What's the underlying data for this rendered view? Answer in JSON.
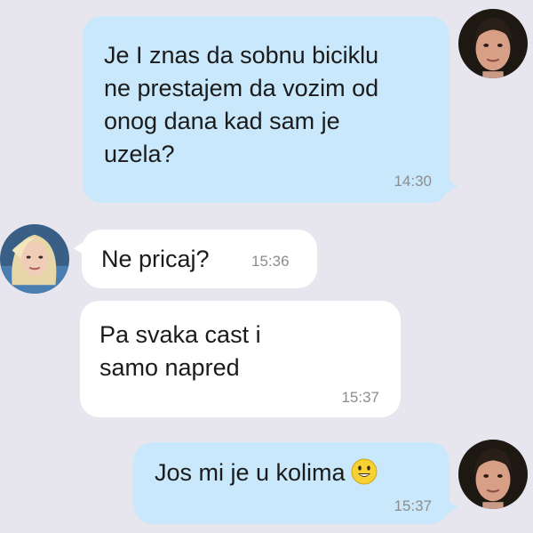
{
  "conversation": {
    "messages": [
      {
        "direction": "outgoing",
        "text": "Je I znas da sobnu biciklu ne prestajem da vozim od onog dana kad sam je uzela?",
        "time": "14:30"
      },
      {
        "direction": "incoming",
        "text": "Ne pricaj?",
        "time": "15:36"
      },
      {
        "direction": "incoming",
        "text": "Pa svaka cast i samo napred",
        "time": "15:37"
      },
      {
        "direction": "outgoing",
        "text": "Jos mi je u kolima",
        "time": "15:37",
        "emoji": "smiling-face-emoji"
      }
    ],
    "avatars": {
      "sender": "woman-dark-hair-avatar",
      "receiver": "woman-blonde-hair-avatar"
    }
  },
  "colors": {
    "background": "#e7e5ee",
    "outgoing_bubble": "#c9e8fb",
    "incoming_bubble": "#ffffff",
    "timestamp": "#8d8d8d"
  }
}
